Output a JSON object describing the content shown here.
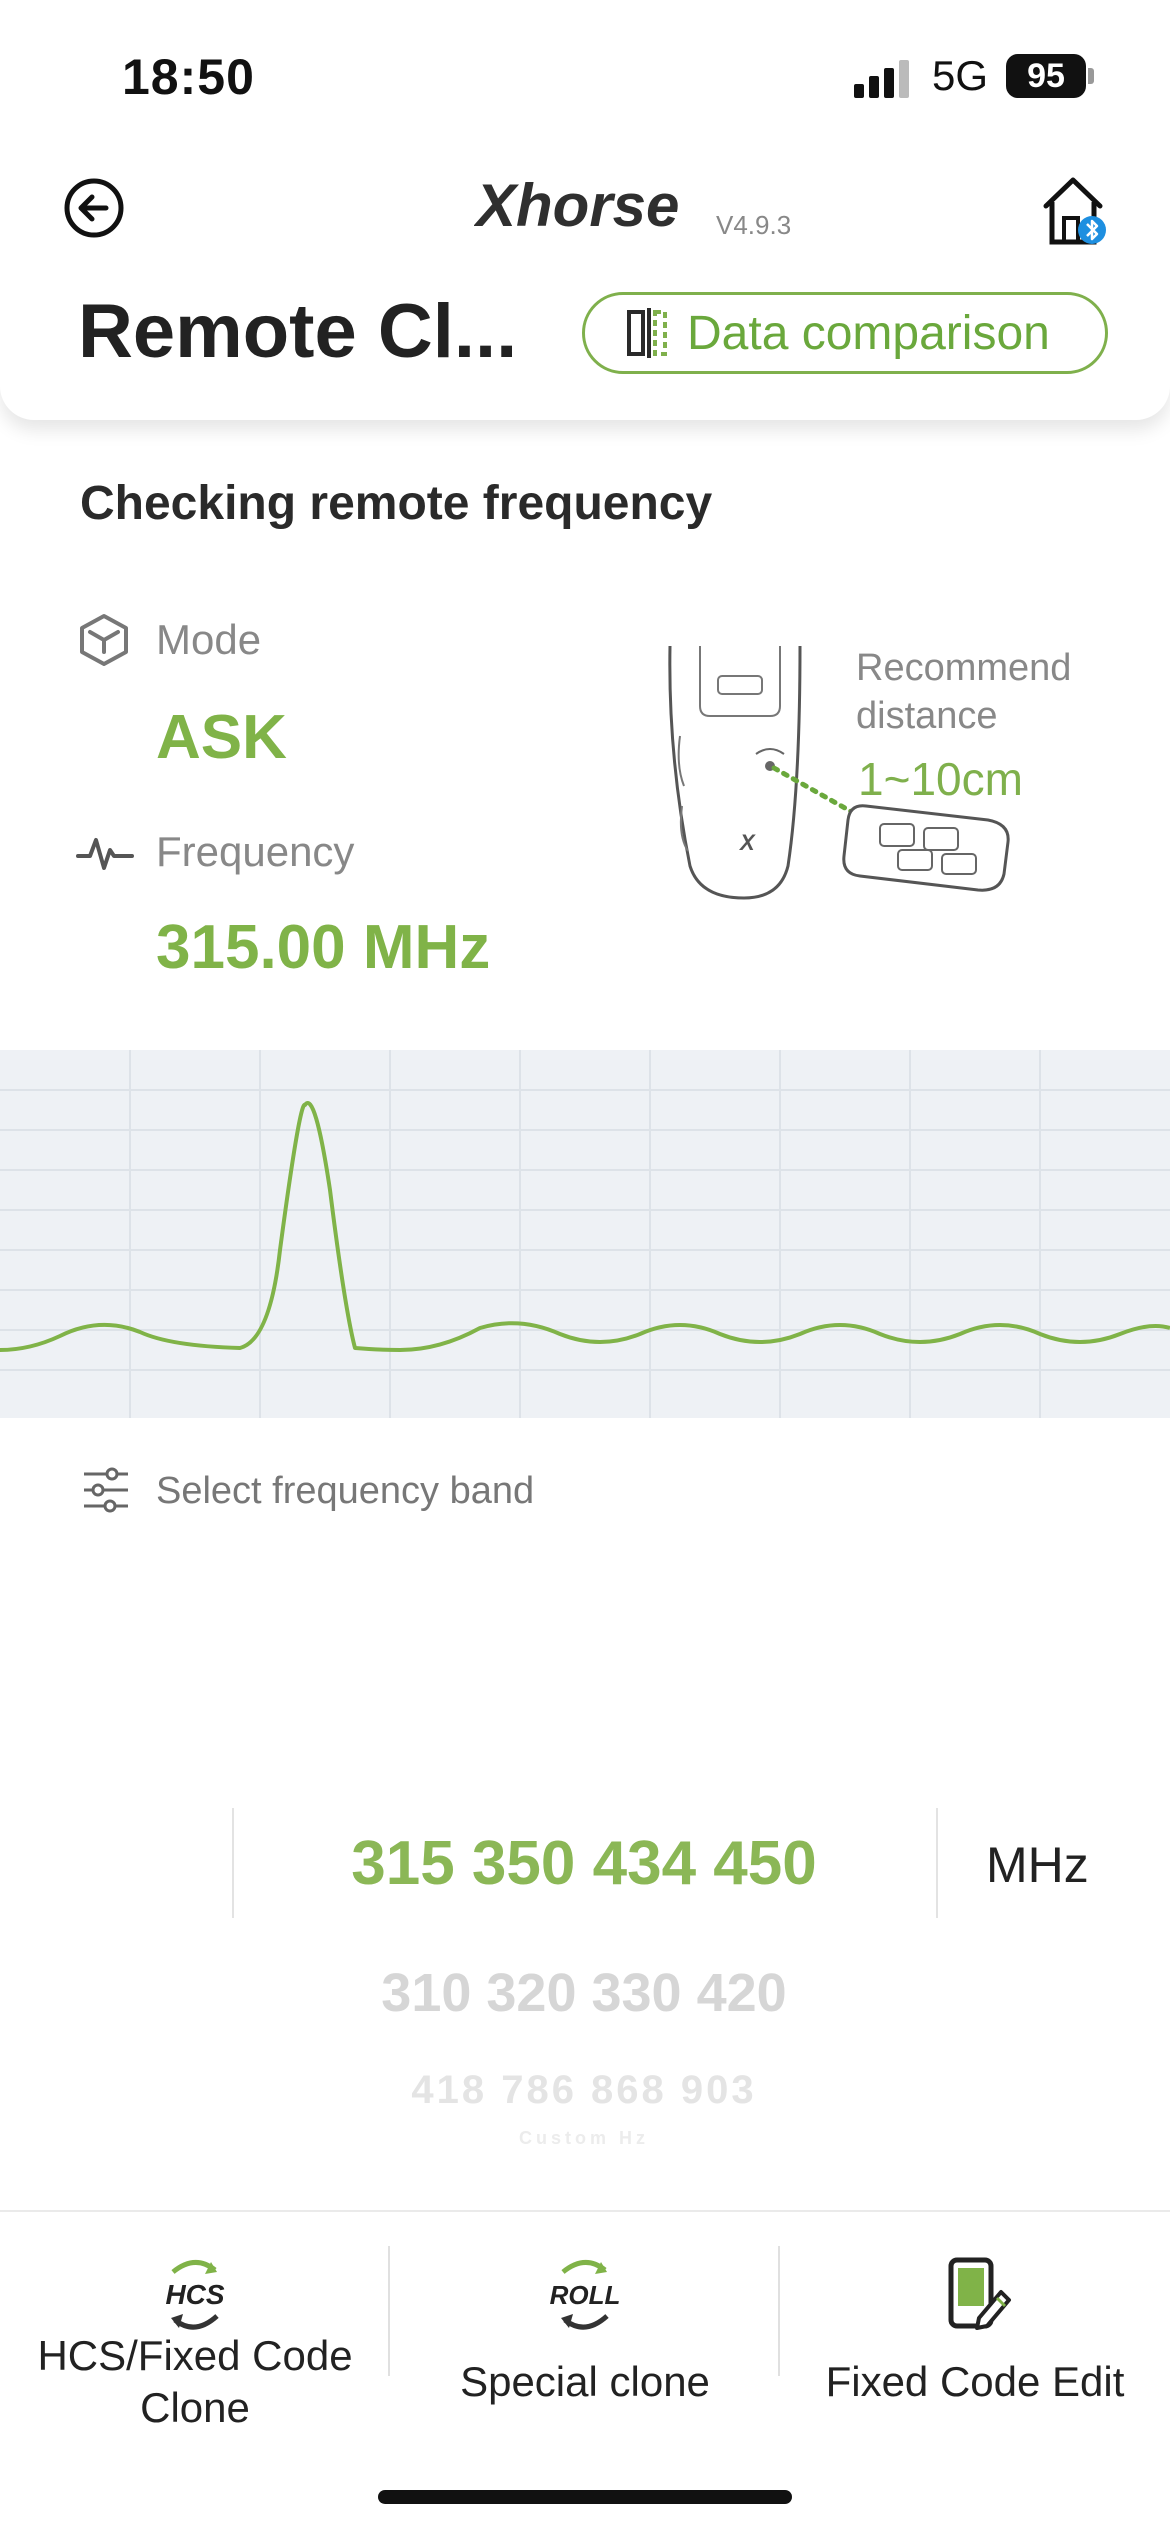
{
  "status_bar": {
    "time": "18:50",
    "network": "5G",
    "battery": "95"
  },
  "header": {
    "brand": "Xhorse",
    "version": "V4.9.3",
    "title": "Remote Cl...",
    "compare_button": "Data comparison"
  },
  "section": {
    "title": "Checking remote frequency",
    "mode_label": "Mode",
    "mode_value": "ASK",
    "frequency_label": "Frequency",
    "frequency_value": "315.00 MHz",
    "recommend_text_line1": "Recommend",
    "recommend_text_line2": "distance",
    "recommend_distance": "1~10cm"
  },
  "band_selector": {
    "label": "Select frequency band",
    "unit": "MHz",
    "selected": "315 350 434 450",
    "options": [
      "310 320 330 420",
      "418 786 868 903",
      "Custom Hz"
    ]
  },
  "bottom_tabs": [
    {
      "icon": "HCS",
      "label_line1": "HCS/Fixed Code",
      "label_line2": "Clone"
    },
    {
      "icon": "ROLL",
      "label_line1": "Special clone"
    },
    {
      "icon": "edit-phone-icon",
      "label_line1": "Fixed Code Edit"
    }
  ],
  "colors": {
    "accent": "#80b348",
    "chart_bg": "#eef1f5"
  }
}
